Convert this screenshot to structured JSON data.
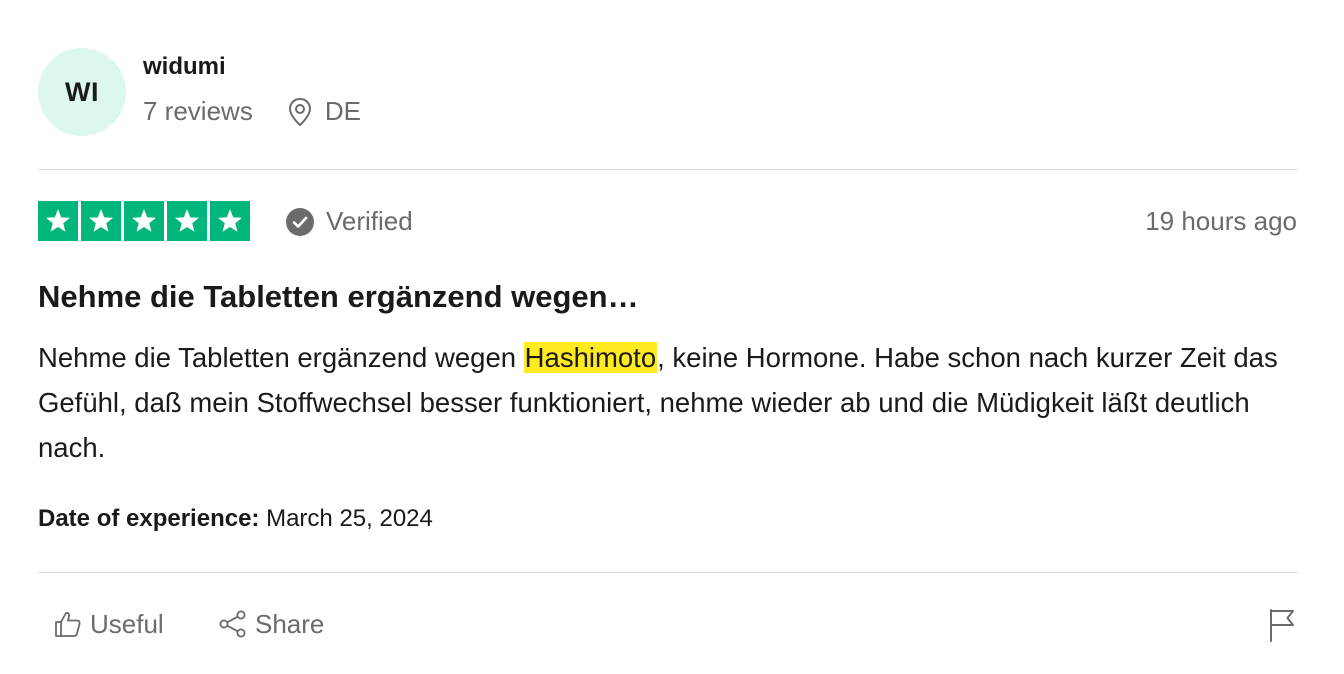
{
  "reviewer": {
    "initials": "WI",
    "name": "widumi",
    "reviews": "7 reviews",
    "country": "DE"
  },
  "rating": {
    "stars": 5,
    "star_color": "#00b67a",
    "verified_label": "Verified",
    "time_ago": "19 hours ago"
  },
  "review": {
    "title": "Nehme die Tabletten ergänzend wegen…",
    "body_before": "Nehme die Tabletten ergänzend wegen ",
    "body_highlight": "Hashimoto",
    "body_after": ", keine Hormone. Habe schon nach kurzer Zeit das Gefühl, daß mein Stoffwechsel besser funktioniert, nehme wieder ab und die Müdigkeit läßt deutlich nach.",
    "highlight_color": "#ffeb1f",
    "date_label": "Date of experience:",
    "date_value": "March 25, 2024"
  },
  "actions": {
    "useful_label": "Useful",
    "share_label": "Share"
  },
  "icons": [
    "location-pin-icon",
    "verified-check-icon",
    "star-icon",
    "thumbs-up-icon",
    "share-icon",
    "flag-icon"
  ]
}
